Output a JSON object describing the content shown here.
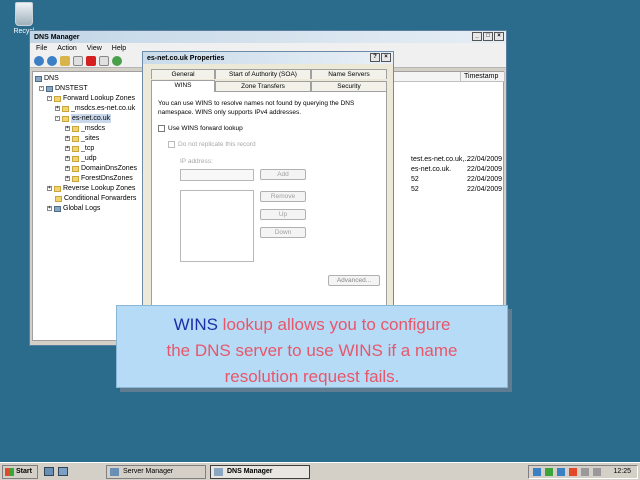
{
  "desktop": {
    "recycle_label": "Recycl"
  },
  "dns_window": {
    "title": "DNS Manager",
    "menu": [
      "File",
      "Action",
      "View",
      "Help"
    ],
    "tree": {
      "root": "DNS",
      "server": "DNSTEST",
      "forward": "Forward Lookup Zones",
      "msdcs": "_msdcs.es-net.co.uk",
      "zone": "es-net.co.uk",
      "children": [
        "_msdcs",
        "_sites",
        "_tcp",
        "_udp",
        "DomainDnsZones",
        "ForestDnsZones"
      ],
      "reverse": "Reverse Lookup Zones",
      "conditional": "Conditional Forwarders",
      "global": "Global Logs"
    },
    "column_timestamp": "Timestamp",
    "rows": [
      {
        "data": "test.es-net.co.uk,...",
        "timestamp": "22/04/2009"
      },
      {
        "data": "es-net.co.uk.",
        "timestamp": "22/04/2009"
      },
      {
        "data": "52",
        "timestamp": "22/04/2009"
      },
      {
        "data": "52",
        "timestamp": "22/04/2009"
      }
    ]
  },
  "dialog": {
    "title": "es-net.co.uk Properties",
    "tabs_top": [
      "General",
      "Start of Authority (SOA)",
      "Name Servers"
    ],
    "tabs_bottom": [
      "WINS",
      "Zone Transfers",
      "Security"
    ],
    "description": "You can use WINS to resolve names not found by querying the DNS namespace. WINS only supports IPv4 addresses.",
    "use_wins": "Use WINS forward lookup",
    "no_replicate": "Do not replicate this record",
    "ip_label": "IP address:",
    "add": "Add",
    "remove": "Remove",
    "up": "Up",
    "down": "Down",
    "advanced": "Advanced..."
  },
  "callout": {
    "word1": "WINS",
    "line1": " lookup allows you to configure",
    "line2": "the DNS server to use WINS if a name",
    "line3": "resolution request fails."
  },
  "taskbar": {
    "start": "Start",
    "items": [
      "Server Manager",
      "DNS Manager"
    ],
    "clock": "12:25"
  }
}
